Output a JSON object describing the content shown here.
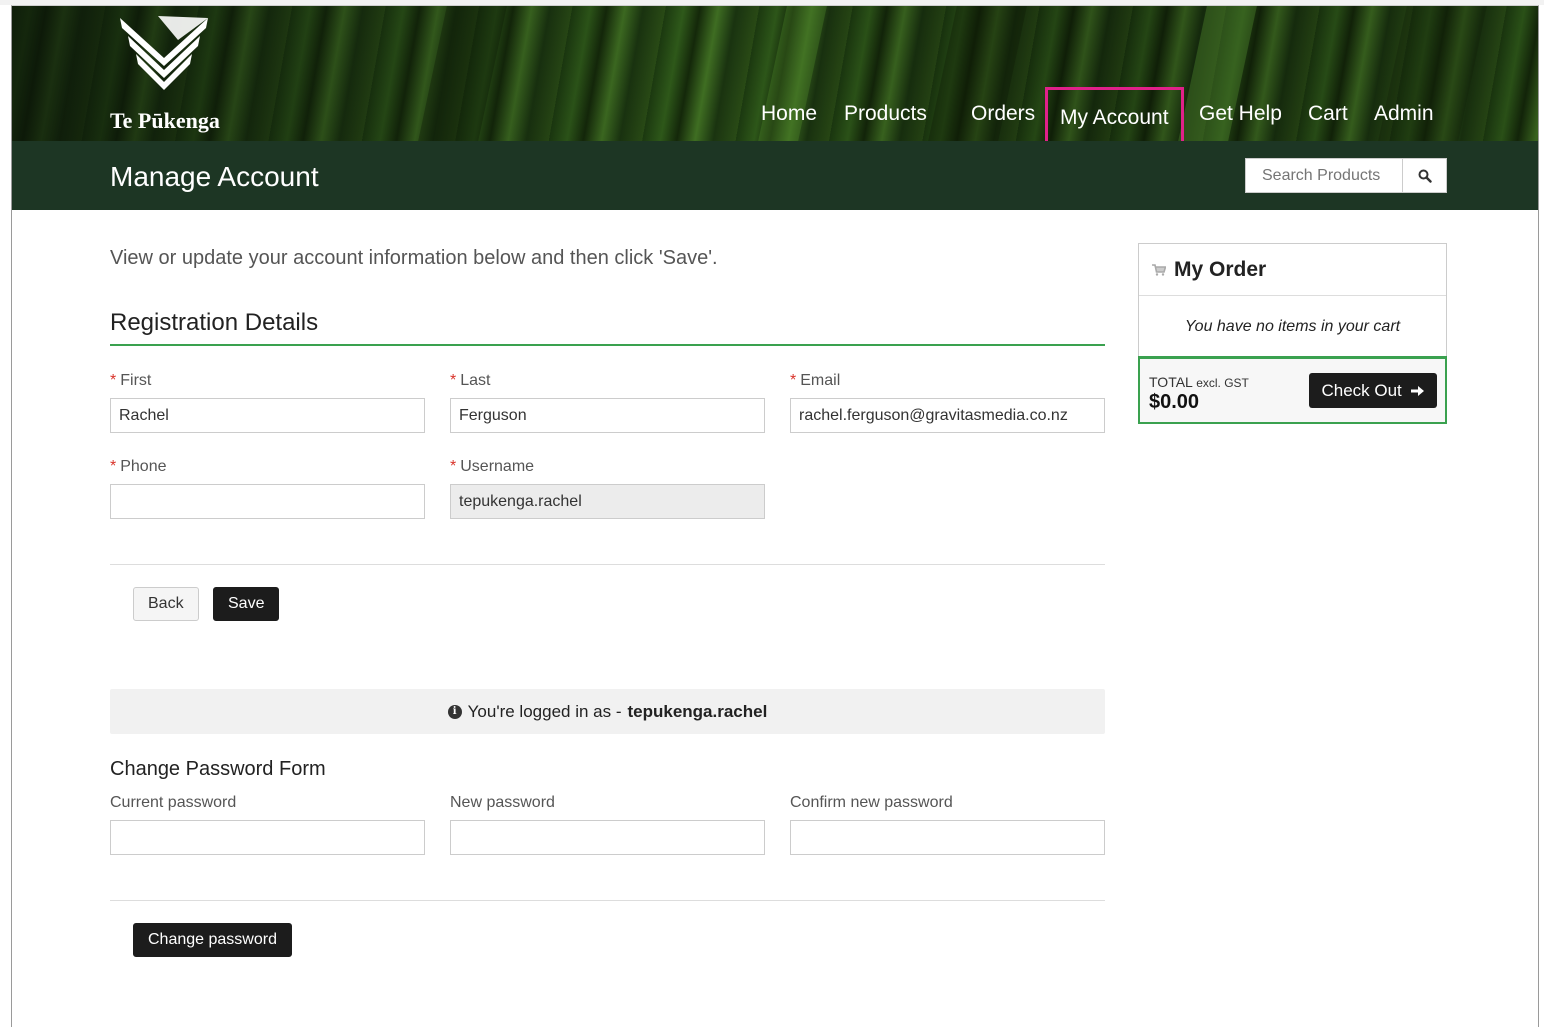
{
  "brand": {
    "name": "Te Pūkenga"
  },
  "nav": {
    "items": [
      {
        "label": "Home"
      },
      {
        "label": "Products"
      },
      {
        "label": "Orders"
      },
      {
        "label": "My Account"
      },
      {
        "label": "Get Help"
      },
      {
        "label": "Cart"
      },
      {
        "label": "Admin"
      }
    ],
    "active": "My Account"
  },
  "titlebar": {
    "title": "Manage Account"
  },
  "search": {
    "placeholder": "Search Products"
  },
  "intro": "View or update your account information below and then click 'Save'.",
  "registration": {
    "title": "Registration Details",
    "fields": {
      "first": {
        "label": "First",
        "value": "Rachel",
        "required": true
      },
      "last": {
        "label": "Last",
        "value": "Ferguson",
        "required": true
      },
      "email": {
        "label": "Email",
        "value": "rachel.ferguson@gravitasmedia.co.nz",
        "required": true
      },
      "phone": {
        "label": "Phone",
        "value": "",
        "required": true
      },
      "username": {
        "label": "Username",
        "value": "tepukenga.rachel",
        "required": true,
        "readonly": true
      }
    },
    "required_marker": "*",
    "back_label": "Back",
    "save_label": "Save"
  },
  "login_info": {
    "prefix": "You're logged in as -",
    "username": "tepukenga.rachel"
  },
  "password_form": {
    "title": "Change Password Form",
    "current_label": "Current password",
    "new_label": "New password",
    "confirm_label": "Confirm new password",
    "submit_label": "Change password"
  },
  "order": {
    "title": "My Order",
    "empty_message": "You have no items in your cart",
    "total_label": "TOTAL",
    "total_suffix": "excl. GST",
    "total_amount": "$0.00",
    "checkout_label": "Check Out"
  },
  "colors": {
    "accent_green": "#3aa14f",
    "titlebar_bg": "#1d3624",
    "active_nav_border": "#e0218a",
    "dark_button": "#1c1c1c",
    "required_star": "#d9342b"
  },
  "icons": [
    "search-icon",
    "cart-icon",
    "info-icon",
    "arrow-right-icon",
    "logo-icon"
  ]
}
